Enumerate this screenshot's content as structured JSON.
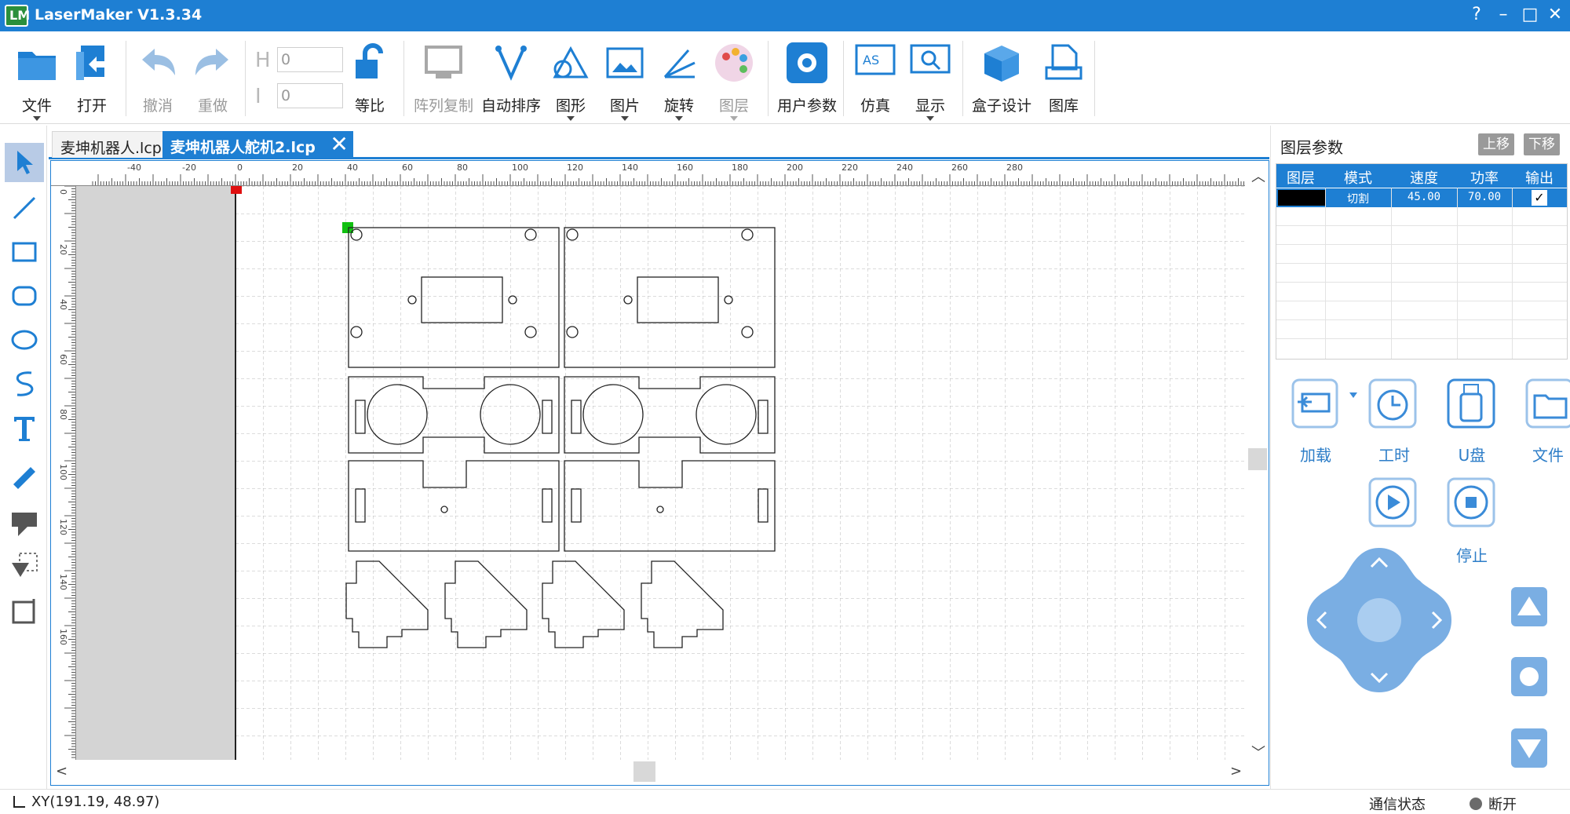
{
  "window": {
    "title": "LaserMaker V1.3.34",
    "logo_text": "LM",
    "controls": {
      "help": "?",
      "minimize": "–",
      "maximize": "□",
      "close": "✕"
    }
  },
  "toolbar": {
    "file": "文件",
    "open": "打开",
    "undo": "撤消",
    "redo": "重做",
    "height_glyph": "H",
    "height_value": "0",
    "width_glyph": "I",
    "width_value": "0",
    "proportional": "等比",
    "array_copy": "阵列复制",
    "auto_sort": "自动排序",
    "shape": "图形",
    "image": "图片",
    "rotate": "旋转",
    "layer": "图层",
    "user_params": "用户参数",
    "simulate": "仿真",
    "display": "显示",
    "box_design": "盒子设计",
    "library": "图库"
  },
  "tabs": [
    {
      "label": "麦坤机器人.lcp",
      "active": false
    },
    {
      "label": "麦坤机器人舵机2.lcp",
      "active": true
    }
  ],
  "ruler": {
    "top_labels": [
      "-40",
      "-20",
      "0",
      "20",
      "40",
      "60",
      "80",
      "100",
      "120",
      "140",
      "160",
      "180",
      "200",
      "220",
      "240",
      "260",
      "280"
    ],
    "left_labels": [
      "0",
      "20",
      "40",
      "60",
      "80",
      "100",
      "120",
      "140",
      "160"
    ]
  },
  "layer_panel": {
    "title": "图层参数",
    "move_up": "上移",
    "move_down": "下移",
    "columns": [
      "图层",
      "模式",
      "速度",
      "功率",
      "输出"
    ],
    "rows": [
      {
        "color": "#000000",
        "mode": "切割",
        "speed": "45.00",
        "power": "70.00",
        "output": "✓"
      }
    ]
  },
  "controls": {
    "load": "加载",
    "work_time": "工时",
    "usb": "U盘",
    "file": "文件",
    "stop": "停止"
  },
  "status": {
    "xy": "XY(191.19, 48.97)",
    "comm_label": "通信状态",
    "connection": "断开"
  },
  "colors": {
    "accent": "#1e7fd3",
    "joystick": "#7aaee3",
    "control_icon": "#3a8bd8",
    "origin_marker": "#e01010",
    "selection_marker": "#10c010"
  }
}
